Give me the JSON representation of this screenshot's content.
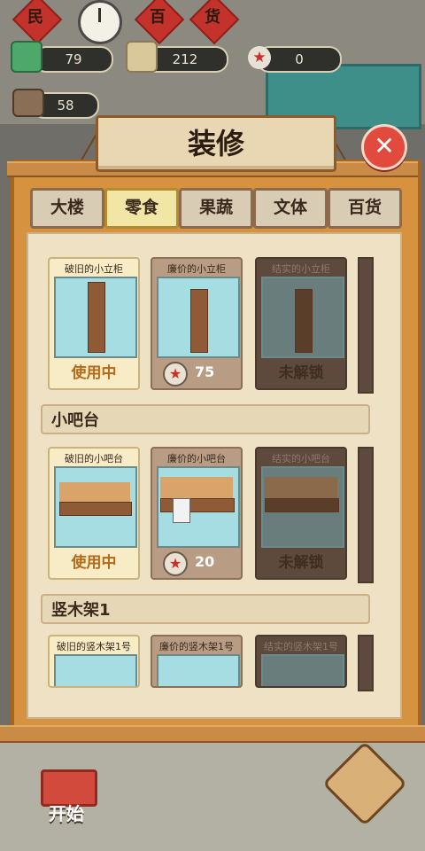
{
  "hud": {
    "sign_chars": [
      "民",
      "百",
      "货"
    ],
    "counters": [
      {
        "name": "cash",
        "value": "79"
      },
      {
        "name": "goods",
        "value": "212"
      },
      {
        "name": "stars",
        "value": "0"
      },
      {
        "name": "shop",
        "value": "58"
      }
    ]
  },
  "dialog": {
    "title": "装修",
    "close_symbol": "✕"
  },
  "tabs": [
    {
      "label": "大楼",
      "active": false
    },
    {
      "label": "零食",
      "active": true
    },
    {
      "label": "果蔬",
      "active": false
    },
    {
      "label": "文体",
      "active": false
    },
    {
      "label": "百货",
      "active": false
    }
  ],
  "sections": [
    {
      "label": "",
      "cards": [
        {
          "title": "破旧的小立柜",
          "status": "使用中"
        },
        {
          "title": "廉价的小立柜",
          "price": "75"
        },
        {
          "title": "结实的小立柜",
          "status": "未解锁"
        }
      ]
    },
    {
      "label": "小吧台",
      "cards": [
        {
          "title": "破旧的小吧台",
          "status": "使用中"
        },
        {
          "title": "廉价的小吧台",
          "price": "20"
        },
        {
          "title": "结实的小吧台",
          "status": "未解锁"
        }
      ]
    },
    {
      "label": "竖木架1",
      "cards": [
        {
          "title": "破旧的竖木架1号"
        },
        {
          "title": "廉价的竖木架1号"
        },
        {
          "title": "结实的竖木架1号"
        }
      ]
    }
  ],
  "bottom": {
    "start_label": "开始"
  },
  "colors": {
    "star": "#c9302c",
    "in_use_text": "#b26a1c",
    "panel_wood": "#d6923f"
  }
}
